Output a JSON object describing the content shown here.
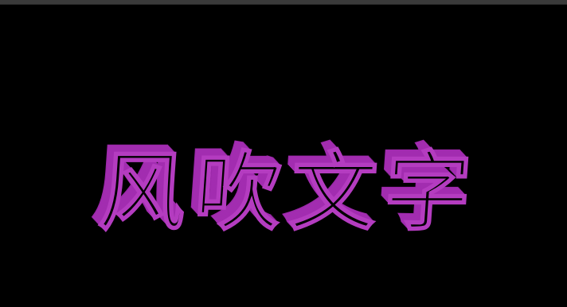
{
  "artwork": {
    "title_chars": [
      "风",
      "吹",
      "文",
      "字"
    ]
  },
  "colors": {
    "background": "#000000",
    "top_bar": "#3a3a3a",
    "text_extrusion": "#a22db0",
    "text_outline": "#b43cc0",
    "text_face": "#000000"
  }
}
